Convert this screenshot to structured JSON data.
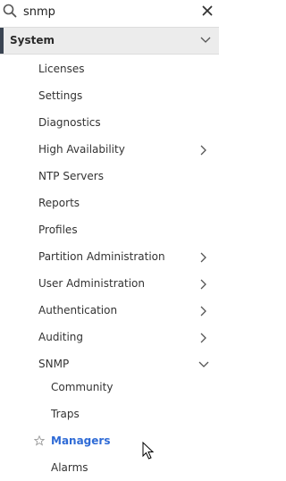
{
  "search": {
    "value": "snmp",
    "placeholder": ""
  },
  "section": {
    "label": "System",
    "expanded": true
  },
  "items": [
    {
      "label": "Licenses"
    },
    {
      "label": "Settings"
    },
    {
      "label": "Diagnostics"
    },
    {
      "label": "High Availability",
      "has_children": true
    },
    {
      "label": "NTP Servers"
    },
    {
      "label": "Reports"
    },
    {
      "label": "Profiles"
    },
    {
      "label": "Partition Administration",
      "has_children": true
    },
    {
      "label": "User Administration",
      "has_children": true
    },
    {
      "label": "Authentication",
      "has_children": true
    },
    {
      "label": "Auditing",
      "has_children": true
    },
    {
      "label": "SNMP",
      "has_children": true,
      "expanded": true
    }
  ],
  "snmp_children": [
    {
      "label": "Community"
    },
    {
      "label": "Traps"
    },
    {
      "label": "Managers",
      "active": true,
      "favorite_icon": "star-outline-icon"
    },
    {
      "label": "Alarms"
    }
  ],
  "colors": {
    "active": "#2f6bd6",
    "section_bg": "#ececec",
    "section_bar": "#3a4452"
  }
}
